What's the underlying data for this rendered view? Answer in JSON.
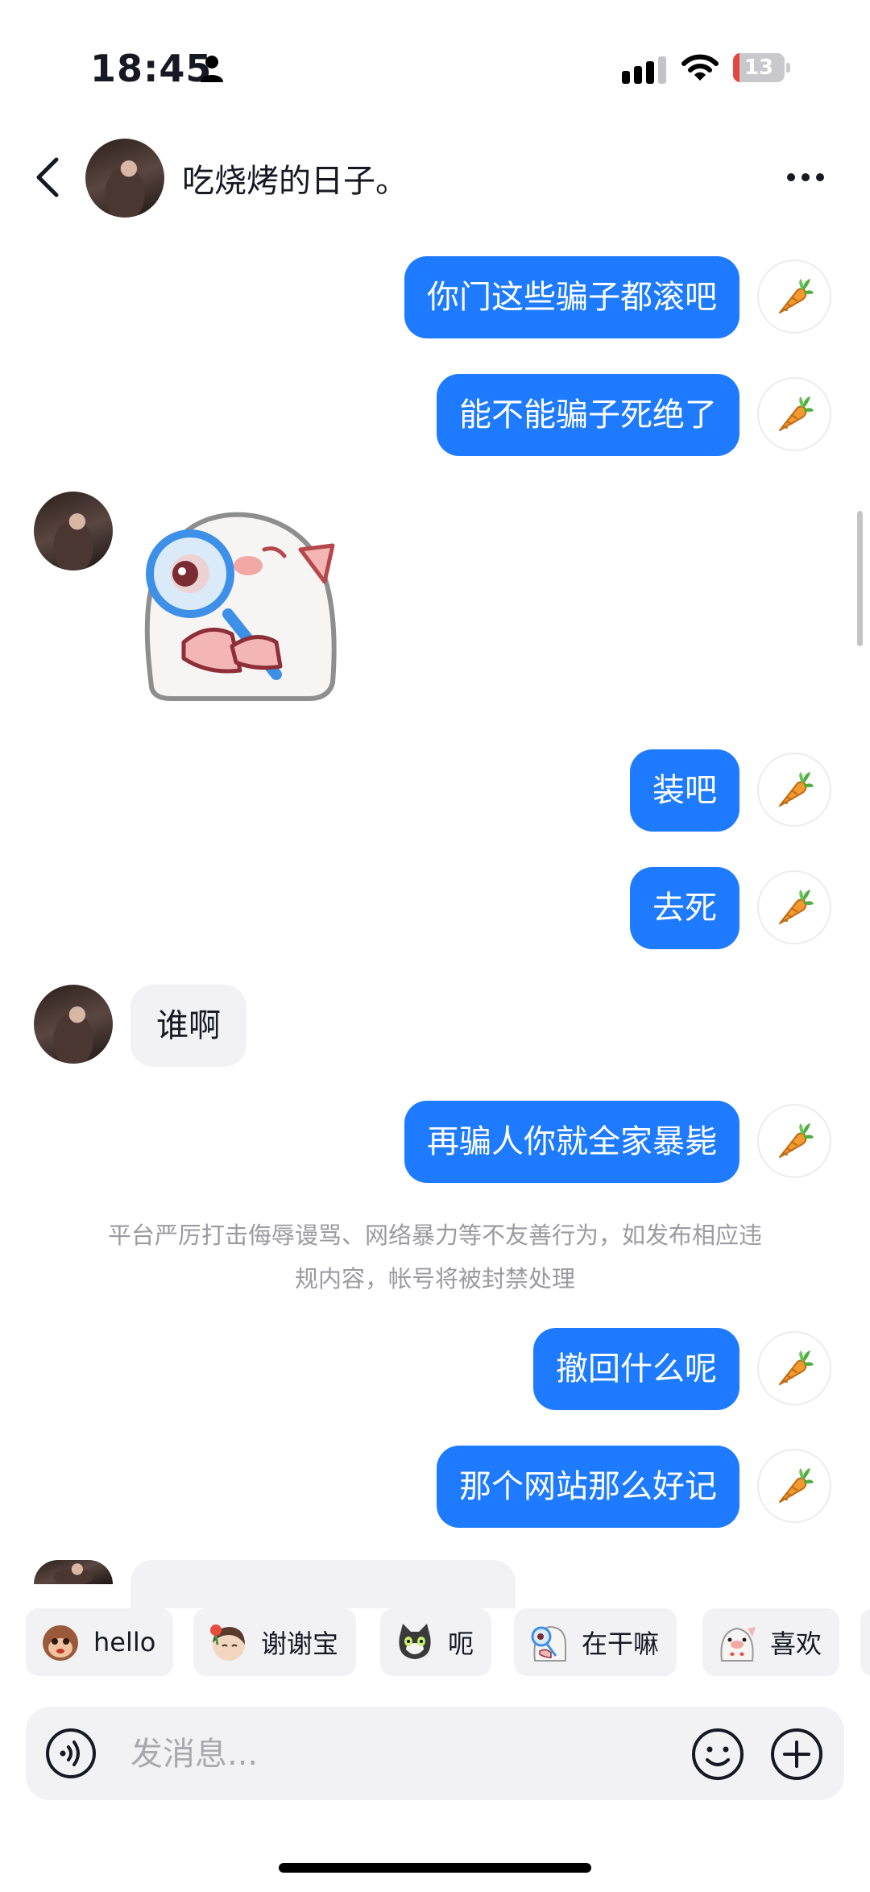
{
  "status_bar": {
    "time": "18:45",
    "battery_level": "13",
    "battery_fraction": 0.13,
    "battery_color": "#e5463f",
    "icons": [
      "person-icon",
      "signal-icon",
      "wifi-icon",
      "battery-icon"
    ]
  },
  "header": {
    "contact_name": "吃烧烤的日子。",
    "icons": [
      "back-arrow-icon",
      "avatar",
      "more-dots-icon"
    ]
  },
  "messages": [
    {
      "side": "out",
      "type": "text",
      "text": "你门这些骗子都滚吧",
      "reaction_icon": "carrot-icon"
    },
    {
      "side": "out",
      "type": "text",
      "text": "能不能骗子死绝了",
      "reaction_icon": "carrot-icon"
    },
    {
      "side": "in",
      "type": "sticker",
      "sticker": "pig-magnifier-sticker"
    },
    {
      "side": "out",
      "type": "text",
      "text": "装吧",
      "reaction_icon": "carrot-icon"
    },
    {
      "side": "out",
      "type": "text",
      "text": "去死",
      "reaction_icon": "carrot-icon"
    },
    {
      "side": "in",
      "type": "text",
      "text": "谁啊"
    },
    {
      "side": "out",
      "type": "text",
      "text": "再骗人你就全家暴毙",
      "reaction_icon": "carrot-icon"
    },
    {
      "side": "out",
      "type": "text",
      "text": "撤回什么呢",
      "reaction_icon": "carrot-icon"
    },
    {
      "side": "out",
      "type": "text",
      "text": "那个网站那么好记",
      "reaction_icon": "carrot-icon"
    }
  ],
  "system_notice": {
    "line1": "平台严厉打击侮辱谩骂、网络暴力等不友善行为，如发布相应违",
    "line2": "规内容，帐号将被封禁处理"
  },
  "quick_replies": [
    {
      "label": "hello",
      "icon": "monkey-sticker-icon"
    },
    {
      "label": "谢谢宝",
      "icon": "girl-flower-sticker-icon"
    },
    {
      "label": "呃",
      "icon": "cat-sticker-icon"
    },
    {
      "label": "在干嘛",
      "icon": "pig-magnifier-sticker-icon"
    },
    {
      "label": "喜欢",
      "icon": "pig-heart-sticker-icon"
    }
  ],
  "composer": {
    "placeholder": "发消息...",
    "icons": [
      "voice-icon",
      "emoji-icon",
      "plus-icon"
    ]
  },
  "colors": {
    "outgoing_bubble": "#1e7bff",
    "incoming_bubble": "#f2f2f4",
    "notice_text": "#9a9aa0"
  }
}
